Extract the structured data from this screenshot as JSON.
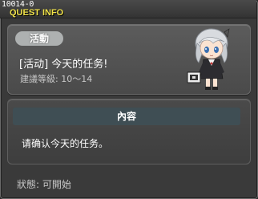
{
  "window": {
    "quest_id": "10014-0",
    "title": "QUEST INFO"
  },
  "quest": {
    "category": "活動",
    "name": "[活动] 今天的任务!",
    "level_text": "建議等級: 10～14",
    "portrait": "npc-portrait-white-haired-girl"
  },
  "content": {
    "tab_label": "內容",
    "text": "请确认今天的任务。"
  },
  "status": {
    "text": "狀態:  可開始"
  },
  "colors": {
    "title_yellow": "#f0e24a",
    "panel_bg": "#4a4a4a",
    "tab_bg": "#3f4e54",
    "badge_bg": "#aeb1b1"
  }
}
